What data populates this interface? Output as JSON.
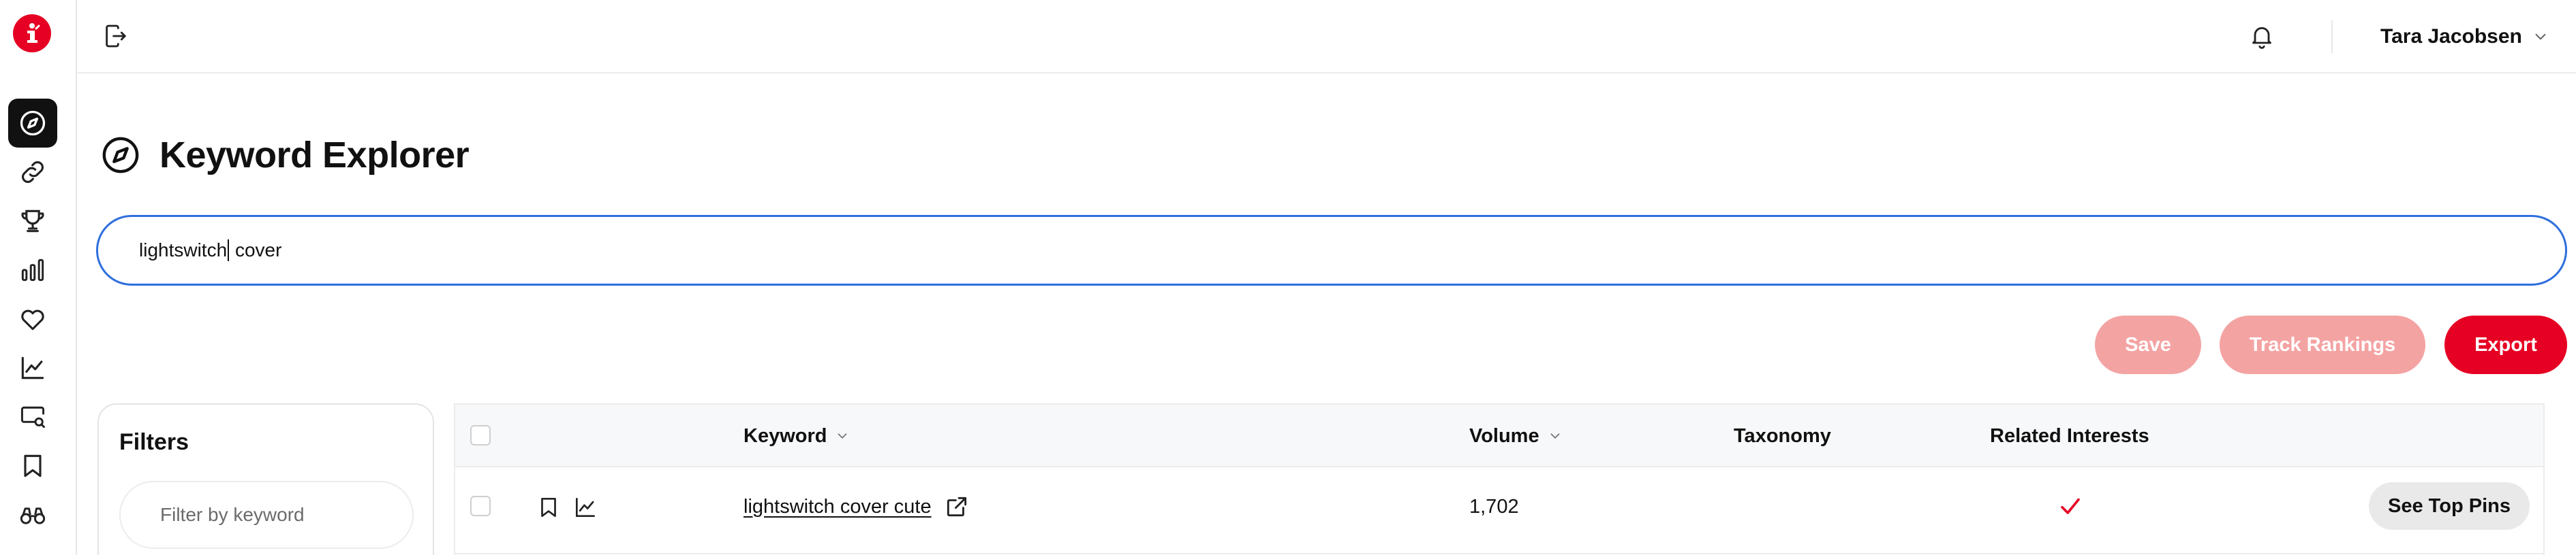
{
  "sidebar": {
    "logo_icon": "brand-logo-icon",
    "items": [
      {
        "name": "explorer",
        "icon": "compass-icon",
        "active": true
      },
      {
        "name": "links",
        "icon": "link-icon",
        "active": false
      },
      {
        "name": "trophy",
        "icon": "trophy-icon",
        "active": false
      },
      {
        "name": "stats",
        "icon": "bar-chart-icon",
        "active": false
      },
      {
        "name": "favorites",
        "icon": "heart-icon",
        "active": false
      },
      {
        "name": "trends",
        "icon": "line-chart-icon",
        "active": false
      },
      {
        "name": "search-monitor",
        "icon": "monitor-search-icon",
        "active": false
      },
      {
        "name": "saved",
        "icon": "bookmark-icon",
        "active": false
      },
      {
        "name": "binoculars",
        "icon": "binoculars-icon",
        "active": false
      }
    ]
  },
  "header": {
    "user_name": "Tara Jacobsen"
  },
  "page": {
    "title": "Keyword Explorer"
  },
  "search": {
    "value_before_caret": "lightswitch",
    "value_after_caret": " cover"
  },
  "actions": {
    "save_label": "Save",
    "track_label": "Track Rankings",
    "export_label": "Export"
  },
  "filters": {
    "title": "Filters",
    "placeholder": "Filter by keyword"
  },
  "table": {
    "columns": {
      "keyword": "Keyword",
      "volume": "Volume",
      "taxonomy": "Taxonomy",
      "related": "Related Interests"
    },
    "rows": [
      {
        "keyword": "lightswitch cover cute",
        "volume": "1,702",
        "taxonomy": "",
        "related_interests": true,
        "action_label": "See Top Pins"
      }
    ]
  },
  "colors": {
    "brand": "#e60023",
    "brand_muted": "#f4a3a3",
    "focus_border": "#2f6fde"
  }
}
